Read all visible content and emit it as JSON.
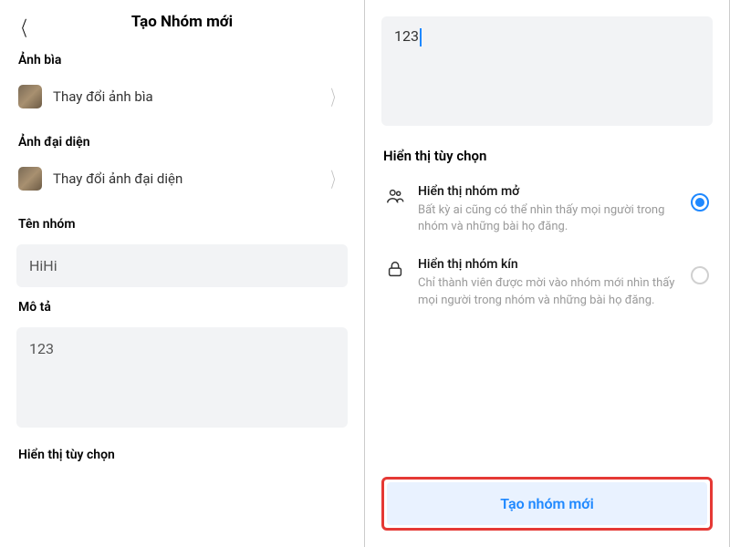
{
  "left": {
    "title": "Tạo Nhóm mới",
    "sections": {
      "cover": {
        "label": "Ảnh bìa",
        "action": "Thay đổi ảnh bìa"
      },
      "avatar": {
        "label": "Ảnh đại diện",
        "action": "Thay đổi ảnh đại diện"
      },
      "name": {
        "label": "Tên nhóm",
        "value": "HiHi"
      },
      "desc": {
        "label": "Mô tả",
        "value": "123"
      },
      "display": {
        "label": "Hiển thị tùy chọn"
      }
    }
  },
  "right": {
    "desc_value": "123",
    "display_label": "Hiển thị tùy chọn",
    "options": {
      "open": {
        "title": "Hiển thị nhóm mở",
        "sub": "Bất kỳ ai cũng có thể nhìn thấy mọi người trong nhóm và những bài họ đăng.",
        "selected": true
      },
      "closed": {
        "title": "Hiển thị nhóm kín",
        "sub": "Chỉ thành viên được mời vào nhóm mới nhìn thấy mọi người trong nhóm và những bài họ đăng.",
        "selected": false
      }
    },
    "create_button": "Tạo nhóm mới"
  }
}
